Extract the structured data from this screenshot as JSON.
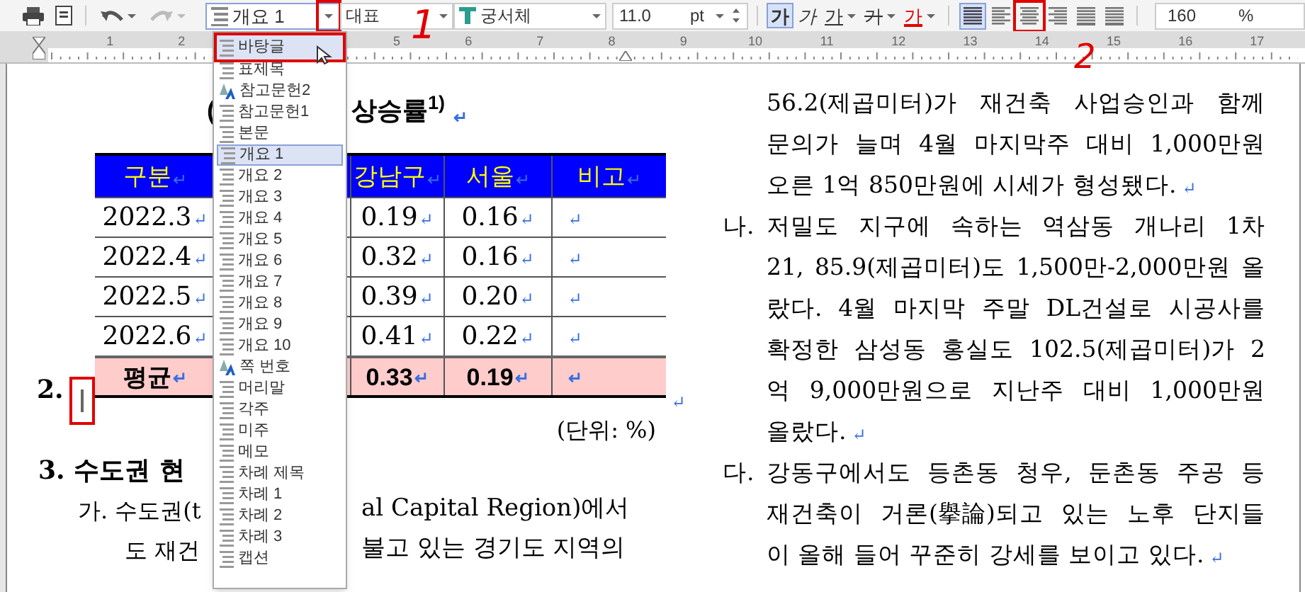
{
  "toolbar": {
    "style": "개요 1",
    "style_button_marked": true,
    "lang": "대표",
    "font": "궁서체",
    "size": "11.0",
    "unit": "pt",
    "zoom": "160",
    "zoom_unit": "%",
    "format_buttons": [
      {
        "label": "가",
        "kind": "bold",
        "selected": true
      },
      {
        "label": "가",
        "kind": "italic",
        "selected": false
      },
      {
        "label": "가",
        "kind": "underline",
        "selected": false
      },
      {
        "label": "가",
        "kind": "strike",
        "selected": false
      },
      {
        "label": "가",
        "kind": "color",
        "selected": false
      }
    ],
    "align_buttons": [
      {
        "kind": "justify",
        "selected": true,
        "marked": false
      },
      {
        "kind": "left",
        "selected": false,
        "marked": false
      },
      {
        "kind": "center",
        "selected": false,
        "marked": true
      },
      {
        "kind": "right",
        "selected": false,
        "marked": false
      },
      {
        "kind": "distribute",
        "selected": false,
        "marked": false
      },
      {
        "kind": "division",
        "selected": false,
        "marked": false
      }
    ]
  },
  "ruler": [
    "1",
    "2",
    "5",
    "6",
    "7",
    "8",
    "9",
    "10",
    "11",
    "12",
    "13",
    "14",
    "15",
    "16",
    "17"
  ],
  "style_menu": {
    "items": [
      {
        "label": "바탕글",
        "kind": "paragraph",
        "hovered": true,
        "selected": false,
        "marked": true
      },
      {
        "label": "표제목",
        "kind": "paragraph",
        "hovered": false,
        "selected": false,
        "marked": false
      },
      {
        "label": "참고문헌2",
        "kind": "character",
        "hovered": false,
        "selected": false,
        "marked": false
      },
      {
        "label": "참고문헌1",
        "kind": "paragraph",
        "hovered": false,
        "selected": false,
        "marked": false
      },
      {
        "label": "본문",
        "kind": "paragraph",
        "hovered": false,
        "selected": false,
        "marked": false
      },
      {
        "label": "개요 1",
        "kind": "paragraph",
        "hovered": false,
        "selected": true,
        "marked": false
      },
      {
        "label": "개요 2",
        "kind": "paragraph",
        "hovered": false,
        "selected": false,
        "marked": false
      },
      {
        "label": "개요 3",
        "kind": "paragraph",
        "hovered": false,
        "selected": false,
        "marked": false
      },
      {
        "label": "개요 4",
        "kind": "paragraph",
        "hovered": false,
        "selected": false,
        "marked": false
      },
      {
        "label": "개요 5",
        "kind": "paragraph",
        "hovered": false,
        "selected": false,
        "marked": false
      },
      {
        "label": "개요 6",
        "kind": "paragraph",
        "hovered": false,
        "selected": false,
        "marked": false
      },
      {
        "label": "개요 7",
        "kind": "paragraph",
        "hovered": false,
        "selected": false,
        "marked": false
      },
      {
        "label": "개요 8",
        "kind": "paragraph",
        "hovered": false,
        "selected": false,
        "marked": false
      },
      {
        "label": "개요 9",
        "kind": "paragraph",
        "hovered": false,
        "selected": false,
        "marked": false
      },
      {
        "label": "개요 10",
        "kind": "paragraph",
        "hovered": false,
        "selected": false,
        "marked": false
      },
      {
        "label": "쪽 번호",
        "kind": "character",
        "hovered": false,
        "selected": false,
        "marked": false
      },
      {
        "label": "머리말",
        "kind": "paragraph",
        "hovered": false,
        "selected": false,
        "marked": false
      },
      {
        "label": "각주",
        "kind": "paragraph",
        "hovered": false,
        "selected": false,
        "marked": false
      },
      {
        "label": "미주",
        "kind": "paragraph",
        "hovered": false,
        "selected": false,
        "marked": false
      },
      {
        "label": "메모",
        "kind": "paragraph",
        "hovered": false,
        "selected": false,
        "marked": false
      },
      {
        "label": "차례 제목",
        "kind": "paragraph",
        "hovered": false,
        "selected": false,
        "marked": false
      },
      {
        "label": "차례 1",
        "kind": "paragraph",
        "hovered": false,
        "selected": false,
        "marked": false
      },
      {
        "label": "차례 2",
        "kind": "paragraph",
        "hovered": false,
        "selected": false,
        "marked": false
      },
      {
        "label": "차례 3",
        "kind": "paragraph",
        "hovered": false,
        "selected": false,
        "marked": false
      },
      {
        "label": "캡션",
        "kind": "paragraph",
        "hovered": false,
        "selected": false,
        "marked": false
      }
    ]
  },
  "document": {
    "left": {
      "title_parts": [
        "(",
        "상승률$^{1)}$"
      ],
      "title_mark": "↵",
      "heading_2": "2.",
      "cursor_marked": true,
      "table": {
        "columns": [
          {
            "label": "구분",
            "mark": "↵"
          },
          {
            "label": "강남구",
            "mark": "↵"
          },
          {
            "label": "서울",
            "mark": "↵"
          },
          {
            "label": "비고",
            "mark": "↵"
          }
        ],
        "rows": [
          {
            "kind": "data",
            "cells": [
              {
                "text": "2022.3",
                "mark": "↵"
              },
              {
                "text": "0.19",
                "mark": "↵"
              },
              {
                "text": "0.16",
                "mark": "↵"
              },
              {
                "mark": "↵"
              }
            ]
          },
          {
            "kind": "data",
            "cells": [
              {
                "text": "2022.4",
                "mark": "↵"
              },
              {
                "text": "0.32",
                "mark": "↵"
              },
              {
                "text": "0.16",
                "mark": "↵"
              },
              {
                "mark": "↵"
              }
            ]
          },
          {
            "kind": "data",
            "cells": [
              {
                "text": "2022.5",
                "mark": "↵"
              },
              {
                "text": "0.39",
                "mark": "↵"
              },
              {
                "text": "0.20",
                "mark": "↵"
              },
              {
                "mark": "↵"
              }
            ]
          },
          {
            "kind": "data",
            "cells": [
              {
                "text": "2022.6",
                "mark": "↵"
              },
              {
                "text": "0.41",
                "mark": "↵"
              },
              {
                "text": "0.22",
                "mark": "↵"
              },
              {
                "mark": "↵"
              }
            ]
          },
          {
            "kind": "average",
            "cells": [
              {
                "text": "평균",
                "mark": "↵"
              },
              {
                "text": "0.33",
                "mark": "↵"
              },
              {
                "text": "0.19",
                "mark": "↵"
              },
              {
                "mark": "↵"
              }
            ]
          }
        ]
      },
      "after_table_mark": "↵",
      "unit_note": "(단위: %)",
      "heading_3": "3. 수도권 현",
      "paragraph_lines": [
        [
          "가. 수도권(t",
          "al Capital Region)에서"
        ],
        [
          "도 재건",
          "불고 있는 경기도 지역의"
        ]
      ]
    },
    "right": {
      "paragraphs": [
        {
          "lines": [
            "56.2(제곱미터)가 재건축 사업승인과 함께",
            "문의가 늘며 4월 마지막주 대비 1,000만원",
            "오른 1억 850만원에 시세가 형성됐다."
          ],
          "mark": "↵"
        },
        {
          "marker": "나.",
          "lines": [
            "저밀도 지구에 속하는 역삼동 개나리 1차",
            "21, 85.9(제곱미터)도 1,500만-2,000만원 올",
            "랐다. 4월 마지막 주말 DL건설로 시공사를",
            "확정한 삼성동 홍실도 102.5(제곱미터)가 2",
            "억 9,000만원으로 지난주 대비 1,000만원",
            "올랐다."
          ],
          "mark": "↵"
        },
        {
          "marker": "다.",
          "lines": [
            "강동구에서도 등촌동 청우, 둔촌동 주공 등",
            "재건축이 거론(擧論)되고 있는 노후 단지들",
            "이 올해 들어 꾸준히 강세를 보이고 있다."
          ],
          "mark": "↵"
        }
      ]
    }
  },
  "annotations": [
    {
      "label": "1"
    },
    {
      "label": "2"
    }
  ]
}
